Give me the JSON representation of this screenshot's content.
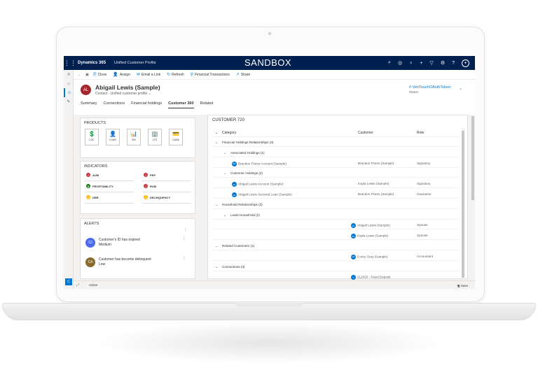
{
  "topbar": {
    "brand": "Dynamics 365",
    "app_name": "Unified Customer Profile",
    "environment": "SANDBOX",
    "icons": [
      "search-icon",
      "target-icon",
      "lightbulb-icon",
      "plus-icon",
      "filter-icon",
      "gear-icon",
      "help-icon",
      "user-icon"
    ]
  },
  "commandbar": {
    "back": "←",
    "items": [
      {
        "icon": "close-icon",
        "glyph": "🗎",
        "label": "Close"
      },
      {
        "icon": "assign-icon",
        "glyph": "👤",
        "label": "Assign"
      },
      {
        "icon": "email-link-icon",
        "glyph": "✉",
        "label": "Email a Link"
      },
      {
        "icon": "refresh-icon",
        "glyph": "↻",
        "label": "Refresh"
      },
      {
        "icon": "financial-transactions-icon",
        "glyph": "⚲",
        "label": "Financial Transactions"
      },
      {
        "icon": "share-icon",
        "glyph": "↗",
        "label": "Share"
      }
    ]
  },
  "header": {
    "avatar": "AL",
    "name": "Abigail Lewis (Sample)",
    "entity": "Contact",
    "form": "Unified customer profile",
    "owner_value": "# VenTouchOAuthToken",
    "owner_label": "Owner",
    "tabs": [
      "Summary",
      "Connections",
      "Financial holdings",
      "Customer 360",
      "Related"
    ],
    "active_tab": "Customer 360"
  },
  "products": {
    "title": "PRODUCTS",
    "items": [
      {
        "label": "LOC",
        "icon": "loc-icon",
        "glyph": "💲"
      },
      {
        "label": "LOAN",
        "icon": "loan-icon",
        "glyph": "👤"
      },
      {
        "label": "INV",
        "icon": "investment-icon",
        "glyph": "📊"
      },
      {
        "label": "LTS",
        "icon": "lts-icon",
        "glyph": "🏢"
      },
      {
        "label": "CASA",
        "icon": "casa-icon",
        "glyph": "💳"
      }
    ]
  },
  "indicators": {
    "title": "INDICATORS",
    "items": [
      {
        "label": "AUM",
        "color": "#d13438",
        "glyph": "!"
      },
      {
        "label": "PEP",
        "color": "#d13438",
        "glyph": "!"
      },
      {
        "label": "PROFITABILITY",
        "color": "#107c10",
        "glyph": "$"
      },
      {
        "label": "RUM",
        "color": "#d13438",
        "glyph": "!"
      },
      {
        "label": "DBR",
        "color": "#ffb900",
        "glyph": "⚖"
      },
      {
        "label": "DELINQUENCY",
        "color": "#ffb900",
        "glyph": "⚠"
      }
    ]
  },
  "alerts": {
    "title": "ALERTS",
    "items": [
      {
        "avatar": "CI",
        "color": "#4f6bed",
        "line1": "Customer's ID has expired",
        "line2": "Medium"
      },
      {
        "avatar": "Ch",
        "color": "#8a6a2a",
        "line1": "Customer has become delinquent",
        "line2": "Low"
      }
    ]
  },
  "customer360": {
    "title": "CUSTOMER 720",
    "columns": [
      "Category",
      "Customer",
      "Role"
    ],
    "rows": [
      {
        "level": 0,
        "label": "Financial Holdings Relationships (3)",
        "customer": "",
        "role": ""
      },
      {
        "level": 1,
        "label": "Associated Holdings (1)",
        "customer": "",
        "role": ""
      },
      {
        "level": 2,
        "label": "Brandon Flores Account (Sample)",
        "badge": "BF",
        "customer": "Brandon Flores (Sample)",
        "role": "Signatory"
      },
      {
        "level": 1,
        "label": "Customer Holdings (2)",
        "customer": "",
        "role": ""
      },
      {
        "level": 2,
        "label": "Abigail Lewis Account (Sample)",
        "badge": "AL",
        "customer": "Kayla Lewis (Sample)",
        "role": "Signatory"
      },
      {
        "level": 2,
        "label": "Abigail Lewis Secured Loan (Sample)",
        "badge": "AL",
        "customer": "Brandon Flores (Sample)",
        "role": "Guarantor"
      },
      {
        "level": 0,
        "label": "Household Relationships (2)",
        "customer": "",
        "role": ""
      },
      {
        "level": 1,
        "label": "Lewis Household (2)",
        "customer": "",
        "role": ""
      },
      {
        "level": 2,
        "label": "",
        "customer_badge": "AL",
        "customer": "Abigail Lewis (Sample)",
        "role": "Spouse"
      },
      {
        "level": 2,
        "label": "",
        "customer_badge": "KL",
        "customer": "Kayla Lewis (Sample)",
        "role": "Spouse"
      },
      {
        "level": 0,
        "label": "Related Customers (1)",
        "customer": "",
        "role": ""
      },
      {
        "level": 2,
        "label": "",
        "customer_badge": "CG",
        "customer": "Corey Gray (Sample)",
        "role": "Accountant"
      },
      {
        "level": 0,
        "label": "Connections (3)",
        "customer": "",
        "role": ""
      },
      {
        "level": 2,
        "label": "",
        "customer_badge": "2",
        "customer": "212020 - Fixed Deposit",
        "role": ""
      }
    ]
  },
  "statusbar": {
    "status": "Active",
    "save": "Save",
    "left_button": "C"
  }
}
